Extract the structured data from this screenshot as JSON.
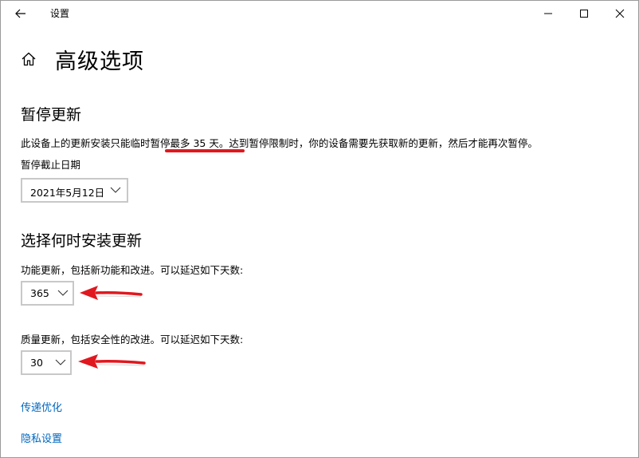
{
  "window": {
    "title": "设置",
    "controls": [
      "minimize-icon",
      "maximize-icon",
      "close-icon"
    ]
  },
  "page": {
    "title": "高级选项"
  },
  "pause": {
    "heading": "暂停更新",
    "description": "此设备上的更新安装只能临时暂停最多 35 天。达到暂停限制时，你的设备需要先获取新的更新，然后才能再次暂停。",
    "date_label": "暂停截止日期",
    "date_value": "2021年5月12日"
  },
  "schedule": {
    "heading": "选择何时安装更新",
    "feature_label": "功能更新，包括新功能和改进。可以延迟如下天数:",
    "feature_value": "365",
    "quality_label": "质量更新，包括安全性的改进。可以延迟如下天数:",
    "quality_value": "30"
  },
  "links": {
    "delivery": "传递优化",
    "privacy": "隐私设置"
  },
  "colors": {
    "link": "#0067c0",
    "annotation_red": "#e0181f",
    "select_border": "#c8c8c8"
  }
}
